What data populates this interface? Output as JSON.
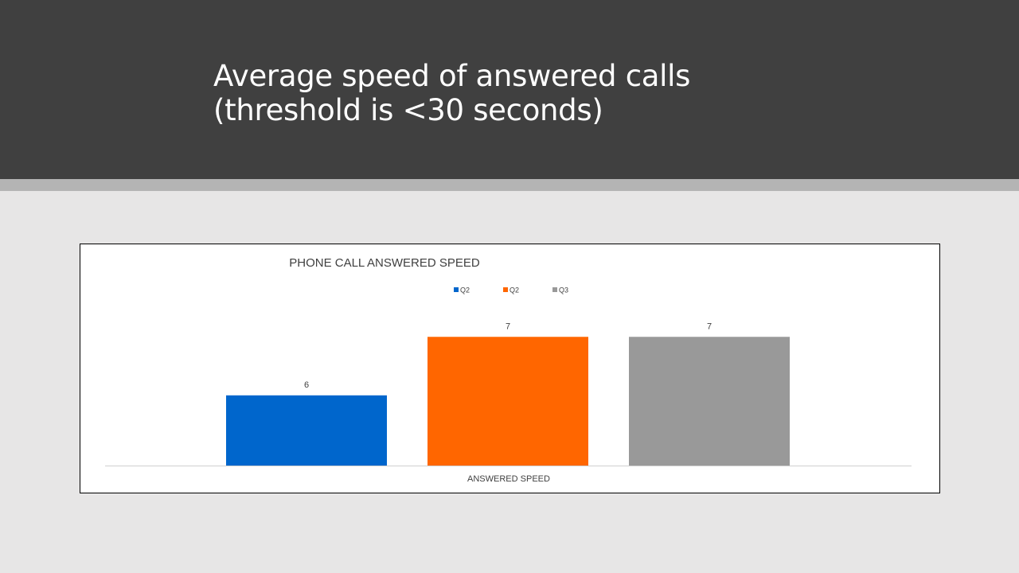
{
  "slide": {
    "title": "Average speed of answered calls (threshold is <30 seconds)"
  },
  "colors": {
    "header_bg": "#404040",
    "header_stripe": "#b4b4b4",
    "slide_bg": "#e7e6e6"
  },
  "chart_data": {
    "type": "bar",
    "title": "PHONE CALL ANSWERED SPEED",
    "categories": [
      "ANSWERED SPEED"
    ],
    "xlabel": "ANSWERED SPEED",
    "ylabel": "",
    "ylim": [
      4.8,
      7.5
    ],
    "grid": false,
    "legend_position": "top",
    "series": [
      {
        "name": "Q2",
        "values": [
          6
        ],
        "color": "#0066cc",
        "label": "6"
      },
      {
        "name": "Q2",
        "values": [
          7
        ],
        "color": "#ff6600",
        "label": "7"
      },
      {
        "name": "Q3",
        "values": [
          7
        ],
        "color": "#999999",
        "label": "7"
      }
    ]
  }
}
